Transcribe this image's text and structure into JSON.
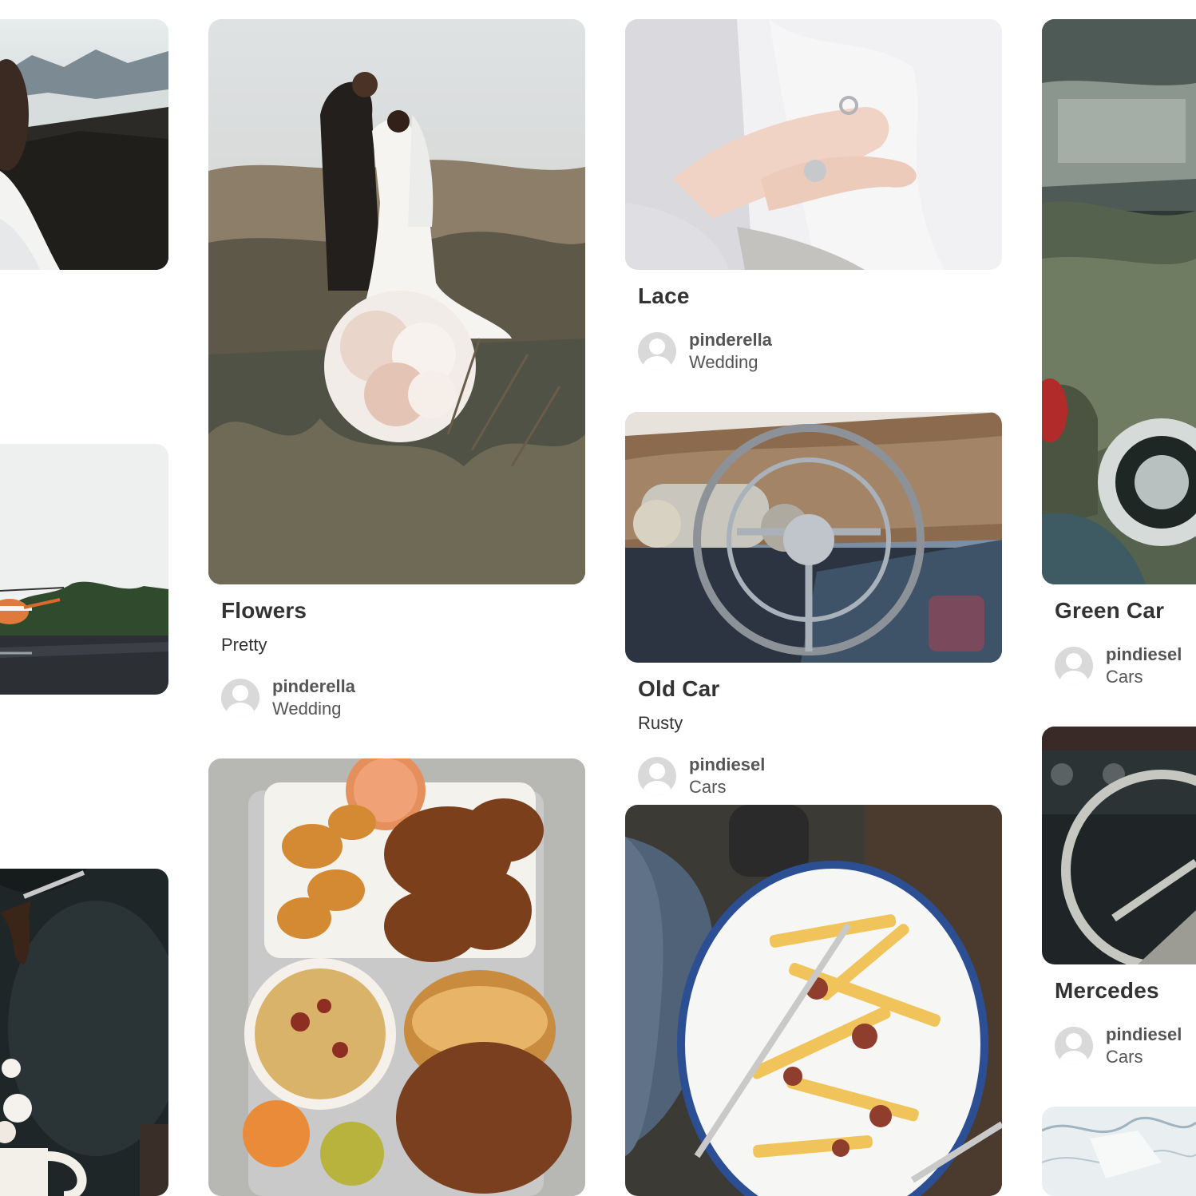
{
  "colors": {
    "background": "#ffffff",
    "title_text": "#333333",
    "meta_text": "#555555",
    "avatar_bg": "#d9d9d9"
  },
  "pins": [
    {
      "id": "wedding-mountain",
      "image": "wedding photo with mountains",
      "title": "",
      "description": "",
      "pinner": "",
      "board": ""
    },
    {
      "id": "helicopter",
      "image": "helicopter on helipad",
      "title": "",
      "description": "",
      "pinner": "",
      "board": ""
    },
    {
      "id": "hot-chocolate",
      "image": "hot chocolate with marshmallows",
      "title": "",
      "description": "",
      "pinner": "",
      "board": ""
    },
    {
      "id": "flowers",
      "image": "wedding couple with bouquet",
      "title": "Flowers",
      "description": "Pretty",
      "pinner": "pinderella",
      "board": "Wedding"
    },
    {
      "id": "fried-chicken",
      "image": "fried chicken tray",
      "title": "",
      "description": "",
      "pinner": "",
      "board": ""
    },
    {
      "id": "lace",
      "image": "hands with rings on lace",
      "title": "Lace",
      "description": "",
      "pinner": "pinderella",
      "board": "Wedding"
    },
    {
      "id": "old-car",
      "image": "rusty car steering wheel",
      "title": "Old Car",
      "description": "Rusty",
      "pinner": "pindiesel",
      "board": "Cars"
    },
    {
      "id": "poutine",
      "image": "poutine fries plate",
      "title": "",
      "description": "",
      "pinner": "",
      "board": ""
    },
    {
      "id": "green-car",
      "image": "green vintage car",
      "title": "Green Car",
      "description": "",
      "pinner": "pindiesel",
      "board": "Cars"
    },
    {
      "id": "mercedes",
      "image": "mercedes steering wheel",
      "title": "Mercedes",
      "description": "",
      "pinner": "pindiesel",
      "board": "Cars"
    },
    {
      "id": "marble",
      "image": "marble texture",
      "title": "",
      "description": "",
      "pinner": "",
      "board": ""
    }
  ]
}
